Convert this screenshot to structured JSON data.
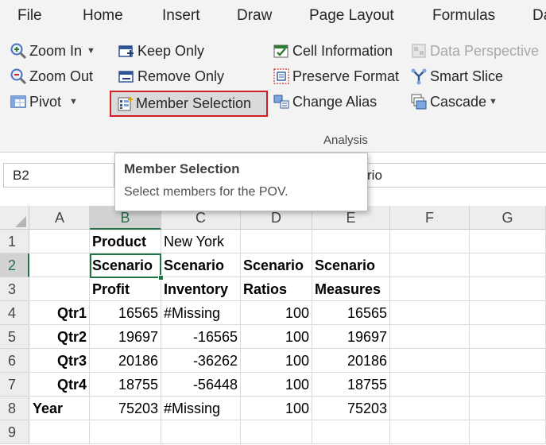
{
  "menu": [
    "File",
    "Home",
    "Insert",
    "Draw",
    "Page Layout",
    "Formulas",
    "Da"
  ],
  "ribbon": {
    "zoom_in": "Zoom In",
    "zoom_out": "Zoom Out",
    "pivot": "Pivot",
    "keep_only": "Keep Only",
    "remove_only": "Remove Only",
    "member_selection": "Member Selection",
    "cell_information": "Cell Information",
    "preserve_format": "Preserve Format",
    "change_alias": "Change Alias",
    "data_perspective": "Data Perspective",
    "smart_slice": "Smart Slice",
    "cascade": "Cascade",
    "group_label": "Analysis",
    "icons": [
      "zoom-in-icon",
      "zoom-out-icon",
      "pivot-icon",
      "keep-only-icon",
      "remove-only-icon",
      "member-selection-icon",
      "cell-information-icon",
      "preserve-format-icon",
      "change-alias-icon",
      "data-perspective-icon",
      "smart-slice-icon",
      "cascade-icon"
    ]
  },
  "formula_bar": {
    "name_box": "B2",
    "formula_visible": "rio"
  },
  "tooltip": {
    "title": "Member Selection",
    "text": "Select members for the POV."
  },
  "colors": {
    "excel_green": "#217346",
    "highlight_red": "#d11f25"
  },
  "grid": {
    "columns": [
      "A",
      "B",
      "C",
      "D",
      "E",
      "F",
      "G"
    ],
    "rows": [
      [
        "",
        "Product",
        "New York",
        "",
        "",
        "",
        ""
      ],
      [
        "",
        "Scenario",
        "Scenario",
        "Scenario",
        "Scenario",
        "",
        ""
      ],
      [
        "",
        "Profit",
        "Inventory",
        "Ratios",
        "Measures",
        "",
        ""
      ],
      [
        "Qtr1",
        "16565",
        "#Missing",
        "100",
        "16565",
        "",
        ""
      ],
      [
        "Qtr2",
        "19697",
        "-16565",
        "100",
        "19697",
        "",
        ""
      ],
      [
        "Qtr3",
        "20186",
        "-36262",
        "100",
        "20186",
        "",
        ""
      ],
      [
        "Qtr4",
        "18755",
        "-56448",
        "100",
        "18755",
        "",
        ""
      ],
      [
        "Year",
        "75203",
        "#Missing",
        "100",
        "75203",
        "",
        ""
      ],
      [
        "",
        "",
        "",
        "",
        "",
        "",
        ""
      ]
    ]
  }
}
